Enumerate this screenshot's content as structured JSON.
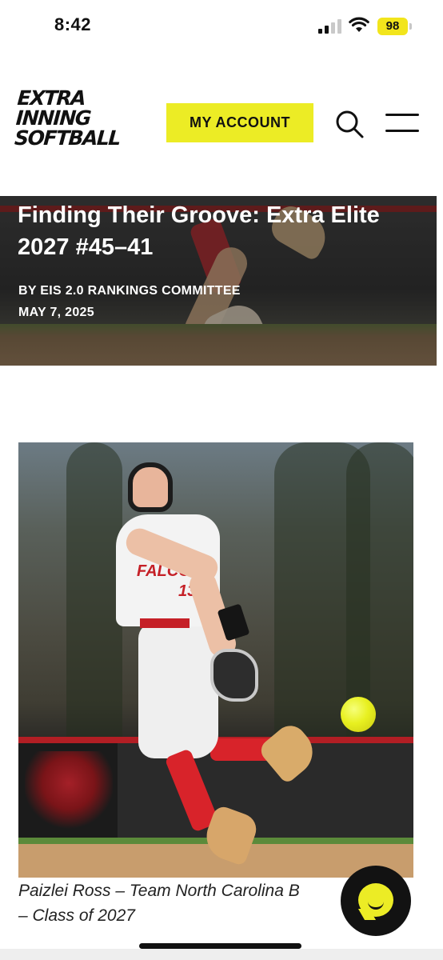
{
  "status_bar": {
    "time": "8:42",
    "battery": "98",
    "battery_color": "#f2e51c"
  },
  "header": {
    "logo_lines": [
      "EXTRA",
      "INNING",
      "SOFTBALL"
    ],
    "account_button": "MY ACCOUNT",
    "accent_color": "#ecec25",
    "icons": [
      "search-icon",
      "hamburger-menu-icon"
    ]
  },
  "article": {
    "title": "Finding Their Groove: Extra Elite 2027 #45–41",
    "byline": "BY EIS 2.0 RANKINGS COMMITTEE",
    "date": "MAY 7, 2025"
  },
  "photo": {
    "jersey_text": "FALCONS",
    "jersey_number": "13",
    "caption": "Paizlei Ross – Team North Carolina B\n– Class of 2027"
  },
  "chat": {
    "icon": "chat-bubble-icon"
  }
}
